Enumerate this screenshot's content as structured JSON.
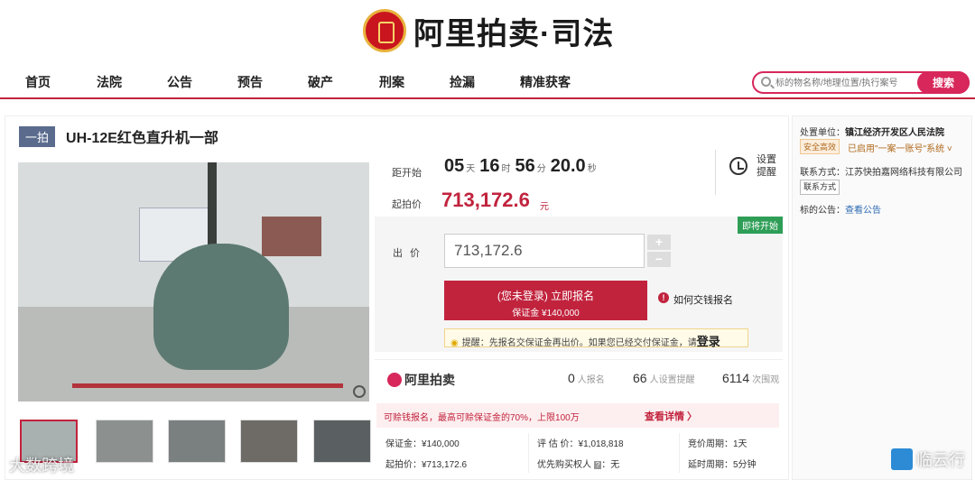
{
  "header": {
    "brand": "阿里拍卖·司法"
  },
  "nav": {
    "items": [
      "首页",
      "法院",
      "公告",
      "预告",
      "破产",
      "刑案",
      "捡漏",
      "精准获客"
    ]
  },
  "search": {
    "placeholder": "标的物名称/地理位置/执行案号",
    "button_label": "搜索"
  },
  "item": {
    "tag": "一拍",
    "title": "UH-12E红色直升机一部"
  },
  "countdown": {
    "label": "距开始",
    "days": "05",
    "days_unit": "天",
    "hours": "16",
    "hours_unit": "时",
    "minutes": "56",
    "minutes_unit": "分",
    "seconds": "20.0",
    "seconds_unit": "秒"
  },
  "starting_price": {
    "label": "起拍价",
    "value": "713,172.6",
    "unit": "元"
  },
  "reminder": {
    "label": "设置提醒"
  },
  "bid": {
    "badge": "即将开始",
    "label": "出价",
    "value": "713,172.6",
    "plus": "+",
    "minus": "−",
    "signup_line1": "(您未登录) 立即报名",
    "signup_line2": "保证金 ¥140,000",
    "how_to_pay": "如何交钱报名",
    "tip_text": "提醒：先报名交保证金再出价。如果您已经交付保证金，请",
    "tip_login": "登录"
  },
  "stats": {
    "brand": "阿里拍卖",
    "signups": "0",
    "signups_label": "人报名",
    "reminders": "66",
    "reminders_label": "人设置提醒",
    "views": "6114",
    "views_label": "次围观"
  },
  "promo": {
    "text": "可赊钱报名，最高可赊保证金的70%，上限100万",
    "link": "查看详情 〉"
  },
  "details": {
    "deposit": "保证金：¥140,000",
    "start_price": "起拍价：¥713,172.6",
    "appraisal": "评 估 价：¥1,018,818",
    "priority": "优先购买权人",
    "priority_value": "：无",
    "cycle": "竞价周期：1天",
    "delay": "延时周期：5分钟"
  },
  "side": {
    "unit_label": "处置单位：",
    "unit_value": "镇江经济开发区人民法院",
    "safe_badge": "安全高效",
    "account_text": "已启用\"一案一账号\"系统 ˅",
    "contact_label": "联系方式：",
    "contact_value": "江苏快拍嘉网络科技有限公司",
    "contact_button": "联系方式",
    "notice_label": "标的公告：",
    "notice_link": "查看公告"
  },
  "watermarks": {
    "left": "大数跨境",
    "right": "临云行"
  },
  "colors": {
    "accent": "#c1233d",
    "search_accent": "#d7275b",
    "green_badge": "#2e9e57",
    "tag_bg": "#5a6b8e"
  }
}
